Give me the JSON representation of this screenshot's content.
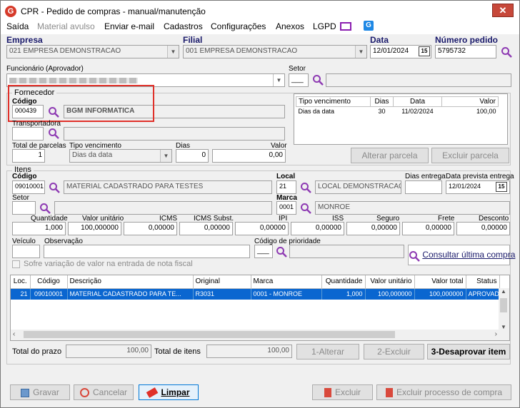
{
  "window": {
    "title": "CPR - Pedido de compras - manual/manutenção",
    "close": "✕"
  },
  "menu": [
    "Saída",
    "Material avulso",
    "Enviar e-mail",
    "Cadastros",
    "Configurações",
    "Anexos",
    "LGPD"
  ],
  "header": {
    "empresa_label": "Empresa",
    "empresa_value": "021 EMPRESA DEMONSTRACAO",
    "filial_label": "Filial",
    "filial_value": "001 EMPRESA DEMONSTRACAO",
    "data_label": "Data",
    "data_value": "12/01/2024",
    "numero_label": "Número pedido",
    "numero_value": "5795732",
    "funcionario_label": "Funcionário (Aprovador)",
    "setor_label": "Setor",
    "setor_value": "___"
  },
  "fornecedor": {
    "group_label": "Fornecedor",
    "codigo_label": "Código",
    "codigo_value": "000439",
    "nome_value": "BGM INFORMATICA",
    "transportadora_label": "Transportadora",
    "total_parcelas_label": "Total de parcelas",
    "total_parcelas_value": "1",
    "tipo_venc_label": "Tipo vencimento",
    "tipo_venc_value": "Dias da data",
    "dias_label": "Dias",
    "dias_value": "0",
    "valor_label": "Valor",
    "valor_value": "0,00"
  },
  "parcelas": {
    "headers": [
      "Tipo vencimento",
      "Dias",
      "Data",
      "Valor"
    ],
    "row": [
      "Dias da data",
      "30",
      "11/02/2024",
      "100,00"
    ],
    "alterar": "Alterar parcela",
    "excluir": "Excluir parcela"
  },
  "itens": {
    "group_label": "Itens",
    "codigo_label": "Código",
    "codigo_value": "09010001",
    "material_value": "MATERIAL CADASTRADO PARA TESTES",
    "local_label": "Local",
    "local_code": "21",
    "local_value": "LOCAL DEMONSTRACAO",
    "dias_entrega_label": "Dias entrega",
    "data_prevista_label": "Data prevista entrega",
    "data_prevista_value": "12/01/2024",
    "setor_label": "Setor",
    "marca_label": "Marca",
    "marca_code": "0001",
    "marca_value": "MONROE",
    "quantidade_label": "Quantidade",
    "quantidade_value": "1,000",
    "valor_unitario_label": "Valor unitário",
    "valor_unitario_value": "100,000000",
    "icms_label": "ICMS",
    "icms_value": "0,00000",
    "icms_subst_label": "ICMS Subst.",
    "icms_subst_value": "0,00000",
    "ipi_label": "IPI",
    "ipi_value": "0,00000",
    "iss_label": "ISS",
    "iss_value": "0,00000",
    "seguro_label": "Seguro",
    "seguro_value": "0,00000",
    "frete_label": "Frete",
    "frete_value": "0,00000",
    "desconto_label": "Desconto",
    "desconto_value": "0,00000",
    "veiculo_label": "Veículo",
    "observacao_label": "Observação",
    "prioridade_label": "Código de prioridade",
    "prioridade_value": "___",
    "consultar": "Consultar última compra",
    "sofre_variacao": "Sofre variação de valor na entrada de nota fiscal"
  },
  "grid": {
    "headers": [
      "Loc.",
      "Código",
      "Descrição",
      "Original",
      "Marca",
      "Quantidade",
      "Valor unitário",
      "Valor total",
      "Status"
    ],
    "row": [
      "21",
      "09010001",
      "MATERIAL CADASTRADO PARA TE...",
      "R3031",
      "0001 - MONROE",
      "1,000",
      "100,000000",
      "100,000000",
      "APROVAD"
    ]
  },
  "totals": {
    "prazo_label": "Total do prazo",
    "prazo_value": "100,00",
    "itens_label": "Total de itens",
    "itens_value": "100,00",
    "alterar": "1-Alterar",
    "excluir": "2-Excluir",
    "desaprovar": "3-Desaprovar item"
  },
  "footer": {
    "gravar": "Gravar",
    "cancelar": "Cancelar",
    "limpar": "Limpar",
    "excluir": "Excluir",
    "excluir_processo": "Excluir processo de compra"
  }
}
